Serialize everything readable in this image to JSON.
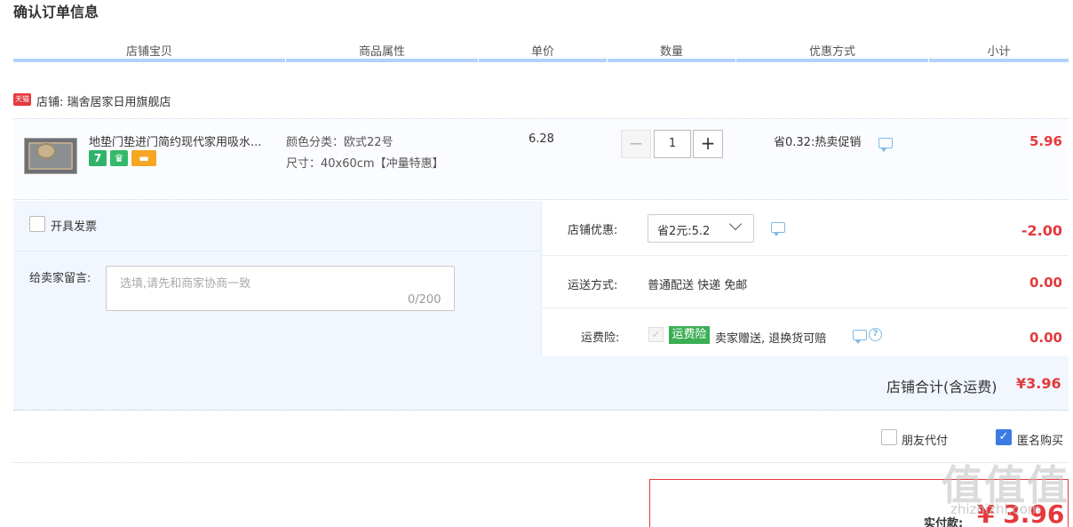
{
  "page_title": "确认订单信息",
  "headers": [
    "店铺宝贝",
    "商品属性",
    "单价",
    "数量",
    "优惠方式",
    "小计"
  ],
  "shop": {
    "badge": "天猫",
    "label": "店铺: 瑞舍居家日用旗舰店"
  },
  "item": {
    "title": "地垫门垫进门简约现代家用吸水...",
    "icons": [
      {
        "name": "seven-day-icon",
        "glyph": "7",
        "color": "#2fb36b"
      },
      {
        "name": "shield-icon",
        "glyph": "♛",
        "color": "#35b96a"
      },
      {
        "name": "card-icon",
        "glyph": "▬",
        "color": "#f5a623"
      }
    ],
    "attr_color": "颜色分类：欧式22号",
    "attr_size": "尺寸：40x60cm【冲量特惠】",
    "unit_price": "6.28",
    "quantity": "1",
    "qty_minus": "−",
    "qty_plus": "+",
    "promo": "省0.32:热卖促销",
    "subtotal": "5.96"
  },
  "invoice": {
    "label": "开具发票",
    "checked": false
  },
  "message": {
    "label": "给卖家留言:",
    "placeholder": "选填,请先和商家协商一致",
    "count": "0/200"
  },
  "shop_discount": {
    "label": "店铺优惠:",
    "selected": "省2元:5.2",
    "amount": "-2.00"
  },
  "shipping": {
    "label": "运送方式:",
    "value": "普通配送 快递 免邮",
    "amount": "0.00"
  },
  "insurance": {
    "label": "运费险:",
    "badge": "运费险",
    "text": "卖家赠送, 退换货可赔",
    "help": "?",
    "amount": "0.00"
  },
  "shop_total": {
    "label": "店铺合计(含运费)",
    "value": "¥3.96"
  },
  "friend_pay": {
    "label": "朋友代付",
    "checked": false
  },
  "anonymous": {
    "label": "匿名购买",
    "checked": true,
    "check_glyph": "✓"
  },
  "payment": {
    "label": "实付款:",
    "value": "¥ 3.96"
  },
  "watermark": {
    "main": "值值值",
    "sub": "zhizhizhi.com"
  }
}
